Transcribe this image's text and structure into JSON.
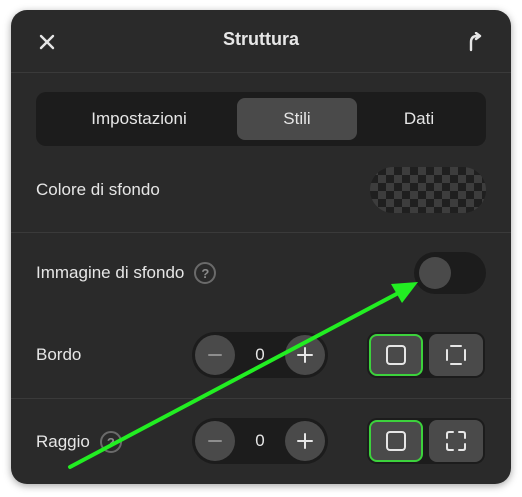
{
  "header": {
    "title": "Struttura",
    "close_icon": "close-icon",
    "share_icon": "share-icon"
  },
  "tabs": [
    {
      "label": "Impostazioni",
      "active": false
    },
    {
      "label": "Stili",
      "active": true
    },
    {
      "label": "Dati",
      "active": false
    }
  ],
  "rows": {
    "background_color": {
      "label": "Colore di sfondo"
    },
    "background_image": {
      "label": "Immagine di sfondo",
      "help": "?",
      "toggle_on": false
    },
    "border": {
      "label": "Bordo",
      "value": "0",
      "minus": "−",
      "plus": "+"
    },
    "radius": {
      "label": "Raggio",
      "help": "?",
      "value": "0",
      "minus": "−",
      "plus": "+"
    }
  },
  "colors": {
    "panel_bg": "#2a2a2a",
    "selected_outline": "#3cd23c",
    "annotation_arrow": "#22ee22"
  }
}
